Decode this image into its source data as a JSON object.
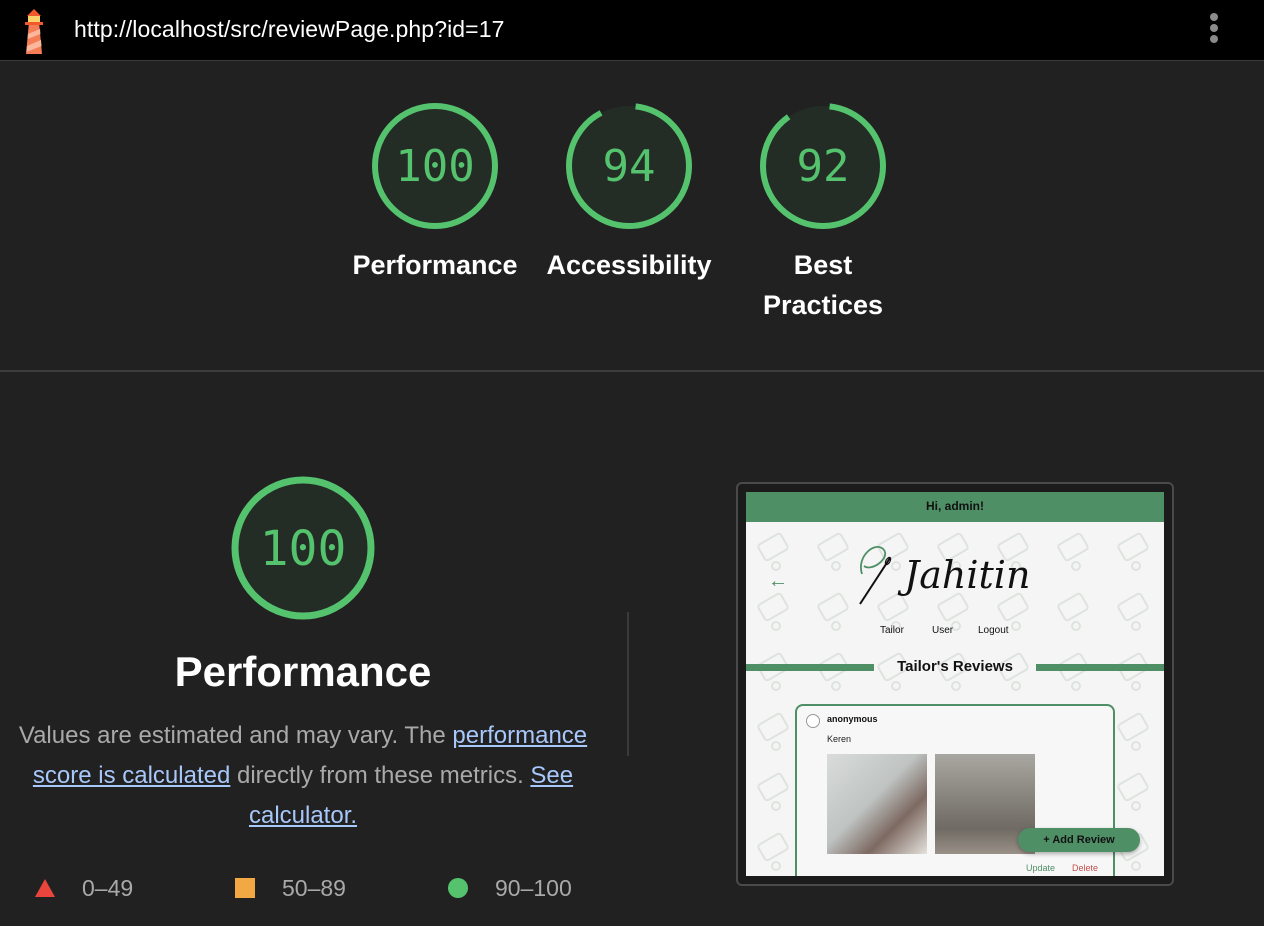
{
  "topbar": {
    "url": "http://localhost/src/reviewPage.php?id=17",
    "logo_icon": "lighthouse-icon",
    "menu_icon": "more-vert-icon"
  },
  "gauges": [
    {
      "score": 100,
      "label": "Performance"
    },
    {
      "score": 94,
      "label": "Accessibility"
    },
    {
      "score": 92,
      "label": "Best Practices"
    }
  ],
  "performance": {
    "score": 100,
    "title": "Performance",
    "desc_prefix": "Values are estimated and may vary. The ",
    "link1": "performance score is calculated",
    "desc_middle": " directly from these metrics. ",
    "link2": "See calculator."
  },
  "legend": [
    {
      "icon": "red-triangle-icon",
      "range": "0–49",
      "color": "#e8453c"
    },
    {
      "icon": "orange-square-icon",
      "range": "50–89",
      "color": "#f2a944"
    },
    {
      "icon": "green-circle-icon",
      "range": "90–100",
      "color": "#55c36e"
    }
  ],
  "colors": {
    "pass": "#55c36e",
    "link": "#a8c7fa",
    "background": "#212121",
    "thumb_accent": "#4e8f66"
  },
  "thumbnail": {
    "greeting": "Hi, admin!",
    "brand": "Jahitin",
    "nav": [
      "Tailor",
      "User",
      "Logout"
    ],
    "heading": "Tailor's Reviews",
    "review_user": "anonymous",
    "review_text": "Keren",
    "add_button": "+ Add Review",
    "update": "Update",
    "delete": "Delete"
  }
}
